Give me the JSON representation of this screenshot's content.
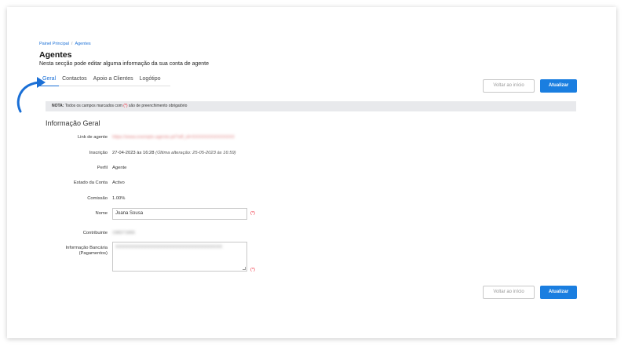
{
  "breadcrumb": {
    "home": "Painel Principal",
    "separator": "/",
    "current": "Agentes"
  },
  "header": {
    "title": "Agentes",
    "subtitle": "Nesta secção pode editar alguma informação da sua conta de agente"
  },
  "tabs": [
    {
      "label": "Geral",
      "active": true
    },
    {
      "label": "Contactos",
      "active": false
    },
    {
      "label": "Apoio a Clientes",
      "active": false
    },
    {
      "label": "Logótipo",
      "active": false
    }
  ],
  "actions": {
    "back_label": "Voltar ao início",
    "update_label": "Atualizar"
  },
  "note": {
    "prefix": "NOTA:",
    "text_before": " Todos os campos marcados com ",
    "required_marker": "(*)",
    "text_after": " são de preenchimento obrigatório"
  },
  "section_title": "Informação Geral",
  "fields": {
    "link_label": "Link de agente",
    "link_value": "https://www.exemplo-agente.pt/?aff_id=XXXXXXXXXXXXXX",
    "inscricao_label": "Inscrição",
    "inscricao_value": "27-04-2023 às 16:28",
    "inscricao_update": "(Última alteração: 25-05-2023 às 16:59)",
    "perfil_label": "Perfil",
    "perfil_value": "Agente",
    "estado_label": "Estado da Conta",
    "estado_value": "Activo",
    "comissao_label": "Comissão",
    "comissao_value": "1.00%",
    "nome_label": "Nome",
    "nome_value": "Joana Sousa",
    "nome_required": "(*)",
    "contribuinte_label": "Contribuinte",
    "contribuinte_value": "198371865",
    "banco_label": "Informação Bancária\n(Pagamentos)",
    "banco_value": "XXXXXXXXXXXXXXXXXXXXXXXXXXXXXXXXXX",
    "banco_required": "(*)"
  },
  "colors": {
    "accent": "#1a7ee0",
    "link": "#1a6fd6",
    "required": "#e22233",
    "note_bg": "#e8e9ec"
  }
}
